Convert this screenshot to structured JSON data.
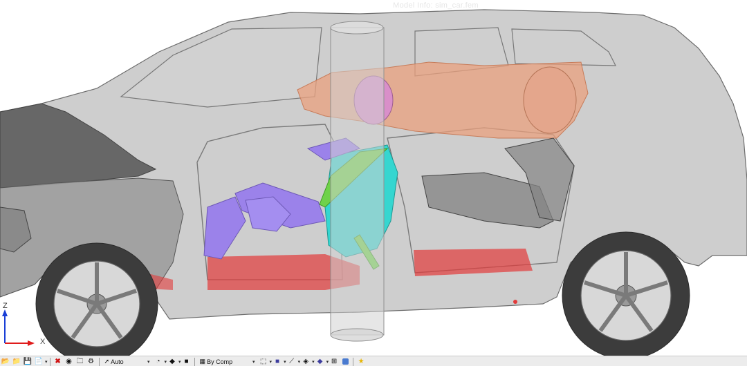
{
  "viewport": {
    "model_info": "Model Info: sim_car.fem",
    "axis_z_label": "Z",
    "axis_x_label": "X"
  },
  "colors": {
    "body": "#b9b9b9",
    "body_dark": "#6d6d6d",
    "hood": "#5a5a5a",
    "floor_red": "#e23a3a",
    "airbag_orange": "#e9a07e",
    "dummy_head": "#d98fc9",
    "dummy_torso": "#35d6d0",
    "dummy_limbs": "#9b82ea",
    "dummy_belt": "#6fd24a",
    "pole": "#cfcfcf",
    "axis_z": "#1a3fd6",
    "axis_x": "#e01c1c"
  },
  "toolbar": {
    "combo_auto": "Auto",
    "combo_comp": "By Comp"
  }
}
